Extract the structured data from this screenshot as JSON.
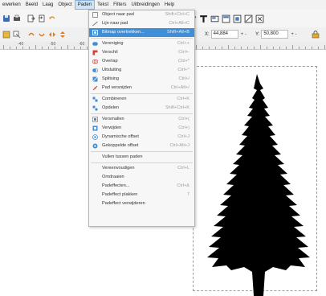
{
  "menubar": {
    "items": [
      "ewerken",
      "Beeld",
      "Laag",
      "Object",
      "Paden",
      "Tekst",
      "Filters",
      "Uitbreidingen",
      "Help"
    ],
    "active": "Paden"
  },
  "toolbar": {
    "x_label": "X:",
    "x_value": "44,884",
    "y_label": "Y:",
    "y_value": "50,800",
    "plusminus": "+ -"
  },
  "ruler": {
    "labels": [
      "-40",
      "-50",
      "-60"
    ]
  },
  "path_menu": {
    "items": [
      {
        "label": "Object naar pad",
        "accel": "Shift+Ctrl+C",
        "icon": "object-to-path-icon",
        "icon_color": "#7a7a7a"
      },
      {
        "label": "Lijn naar pad",
        "accel": "Ctrl+Alt+C",
        "icon": "stroke-to-path-icon",
        "icon_color": "#7a7a7a"
      },
      {
        "label": "Bitmap overtrekken...",
        "accel": "Shift+Alt+B",
        "icon": "trace-bitmap-icon",
        "icon_color": "#ffffff",
        "highlighted": true
      },
      {
        "label": "Vereniging",
        "accel": "Ctrl++",
        "icon": "union-icon",
        "icon_color": "#3f8ed8"
      },
      {
        "label": "Verschil",
        "accel": "Ctrl+-",
        "icon": "difference-icon",
        "icon_color": "#d9413a"
      },
      {
        "label": "Overlap",
        "accel": "Ctrl+*",
        "icon": "intersection-icon",
        "icon_color": "#d9413a"
      },
      {
        "label": "Uitsluiting",
        "accel": "Ctrl+^",
        "icon": "exclusion-icon",
        "icon_color": "#3f8ed8"
      },
      {
        "label": "Splitsing",
        "accel": "Ctrl+/",
        "icon": "division-icon",
        "icon_color": "#3f8ed8"
      },
      {
        "label": "Pad versnijden",
        "accel": "Ctrl+Alt+/",
        "icon": "cut-path-icon",
        "icon_color": "#d9413a"
      },
      {
        "label": "Combineren",
        "accel": "Ctrl+K",
        "icon": "combine-icon",
        "icon_color": "#3f8ed8"
      },
      {
        "label": "Opdelen",
        "accel": "Shift+Ctrl+K",
        "icon": "break-apart-icon",
        "icon_color": "#3f8ed8"
      },
      {
        "label": "Versmallen",
        "accel": "Ctrl+(",
        "icon": "inset-icon",
        "icon_color": "#3f8ed8"
      },
      {
        "label": "Verwijden",
        "accel": "Ctrl+)",
        "icon": "outset-icon",
        "icon_color": "#3f8ed8"
      },
      {
        "label": "Dynamische offset",
        "accel": "Ctrl+J",
        "icon": "dynamic-offset-icon",
        "icon_color": "#3f8ed8"
      },
      {
        "label": "Gekoppelde offset",
        "accel": "Ctrl+Alt+J",
        "icon": "linked-offset-icon",
        "icon_color": "#3f8ed8"
      },
      {
        "label": "Vullen tussen paden",
        "accel": "",
        "icon": "",
        "icon_color": ""
      },
      {
        "label": "Vereenvoudigen",
        "accel": "Ctrl+L",
        "icon": "",
        "icon_color": ""
      },
      {
        "label": "Omdraaien",
        "accel": "",
        "icon": "",
        "icon_color": ""
      },
      {
        "label": "Padeffecten...",
        "accel": "Ctrl+&",
        "icon": "",
        "icon_color": ""
      },
      {
        "label": "Padeffect plakken",
        "accel": "7",
        "icon": "",
        "icon_color": ""
      },
      {
        "label": "Padeffect verwijderen",
        "accel": "",
        "icon": "",
        "icon_color": ""
      }
    ]
  },
  "colors": {
    "highlight": "#3f8ed8",
    "tree": "#000000"
  }
}
